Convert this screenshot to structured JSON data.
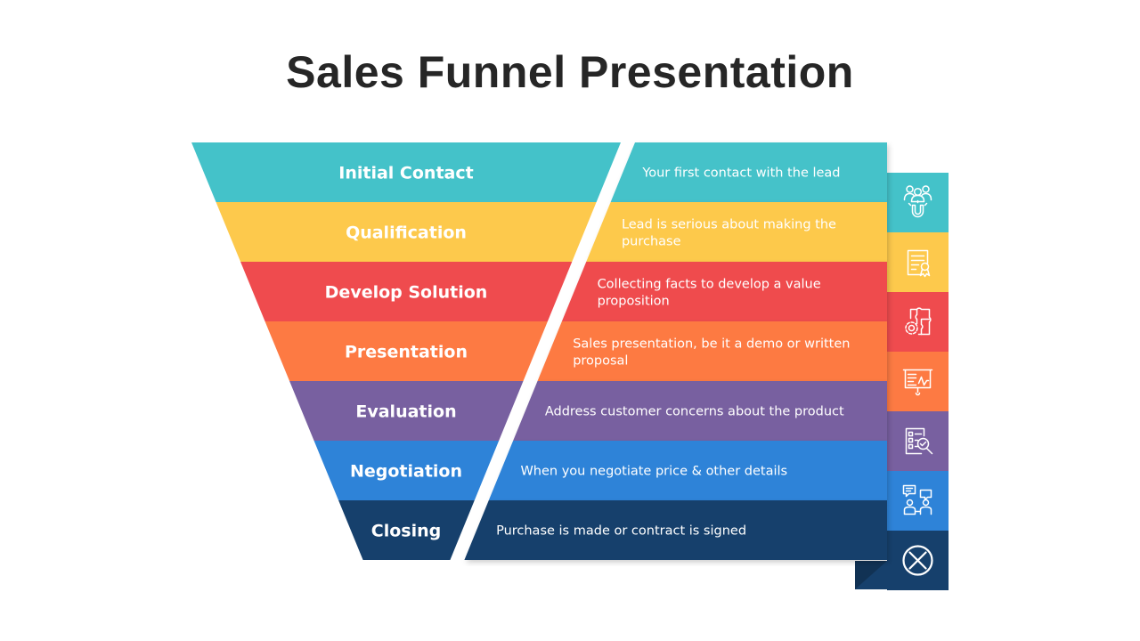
{
  "title": "Sales Funnel Presentation",
  "stages": [
    {
      "name": "Initial Contact",
      "description": [
        "Your first contact with the lead"
      ],
      "icon": "team-magnet-icon",
      "color": "#44C2C9"
    },
    {
      "name": "Qualification",
      "description": [
        "Lead is serious about making the",
        "purchase"
      ],
      "icon": "certificate-icon",
      "color": "#FDC94C"
    },
    {
      "name": "Develop Solution",
      "description": [
        "Collecting facts to develop a value",
        "proposition"
      ],
      "icon": "puzzle-gear-icon",
      "color": "#EF4B4E"
    },
    {
      "name": "Presentation",
      "description": [
        "Sales presentation, be it a demo or written",
        "proposal"
      ],
      "icon": "presentation-board-icon",
      "color": "#FD7A43"
    },
    {
      "name": "Evaluation",
      "description": [
        "Address customer concerns about the product"
      ],
      "icon": "checklist-search-icon",
      "color": "#7860A0"
    },
    {
      "name": "Negotiation",
      "description": [
        "When you negotiate  price & other details"
      ],
      "icon": "conversation-icon",
      "color": "#2E83D8"
    },
    {
      "name": "Closing",
      "description": [
        "Purchase is made or contract is signed"
      ],
      "icon": "close-circle-icon",
      "color": "#16406C"
    }
  ]
}
